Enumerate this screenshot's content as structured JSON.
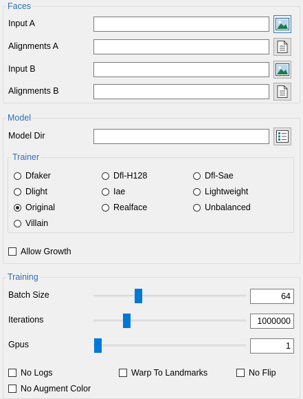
{
  "faces": {
    "legend": "Faces",
    "rows": [
      {
        "label": "Input A",
        "value": "",
        "icon": "image-icon"
      },
      {
        "label": "Alignments A",
        "value": "",
        "icon": "document-icon"
      },
      {
        "label": "Input B",
        "value": "",
        "icon": "image-icon"
      },
      {
        "label": "Alignments B",
        "value": "",
        "icon": "document-icon"
      }
    ]
  },
  "model": {
    "legend": "Model",
    "model_dir_label": "Model Dir",
    "model_dir_value": "",
    "model_dir_icon": "folder-list-icon",
    "trainer": {
      "legend": "Trainer",
      "options": [
        "Dfaker",
        "Dfl-H128",
        "Dfl-Sae",
        "Dlight",
        "Iae",
        "Lightweight",
        "Original",
        "Realface",
        "Unbalanced",
        "Villain"
      ],
      "selected": "Original"
    },
    "allow_growth": {
      "label": "Allow Growth",
      "checked": false
    }
  },
  "training": {
    "legend": "Training",
    "batch_size": {
      "label": "Batch Size",
      "value": "64",
      "level": 0.28
    },
    "iterations": {
      "label": "Iterations",
      "value": "1000000",
      "level": 0.2
    },
    "gpus": {
      "label": "Gpus",
      "value": "1",
      "level": 0.0
    },
    "checkboxes": {
      "no_logs": "No Logs",
      "warp_to_landmarks": "Warp To Landmarks",
      "no_flip": "No Flip",
      "no_augment_color": "No Augment Color"
    }
  },
  "colors": {
    "accent": "#0078d7",
    "legend": "#2f6fb8"
  }
}
